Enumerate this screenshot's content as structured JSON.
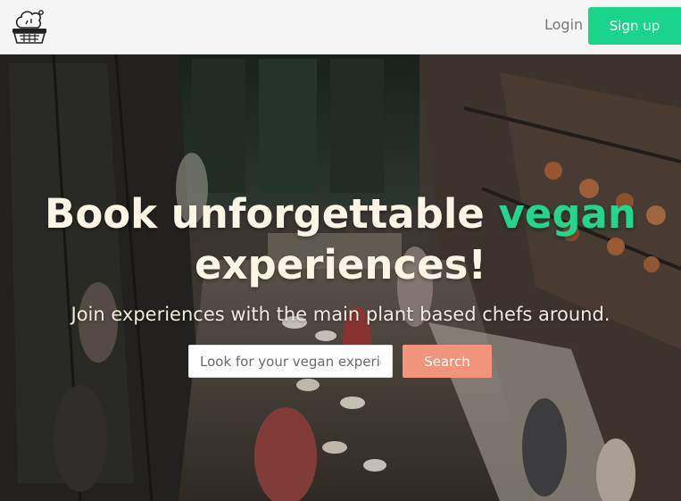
{
  "navbar": {
    "logo_icon": "chef-basket-logo-icon",
    "login_label": "Login",
    "signup_label": "Sign up"
  },
  "hero": {
    "headline_part1": "Book unforgettable ",
    "headline_accent": "vegan",
    "headline_part2": "experiences!",
    "subheadline": "Join experiences with the main plant based chefs around.",
    "search_placeholder": "Look for your vegan experiences",
    "search_button_label": "Search"
  },
  "colors": {
    "accent_green": "#1ad48c",
    "search_button": "#f0957c",
    "headline_text": "#fbf5e6"
  }
}
